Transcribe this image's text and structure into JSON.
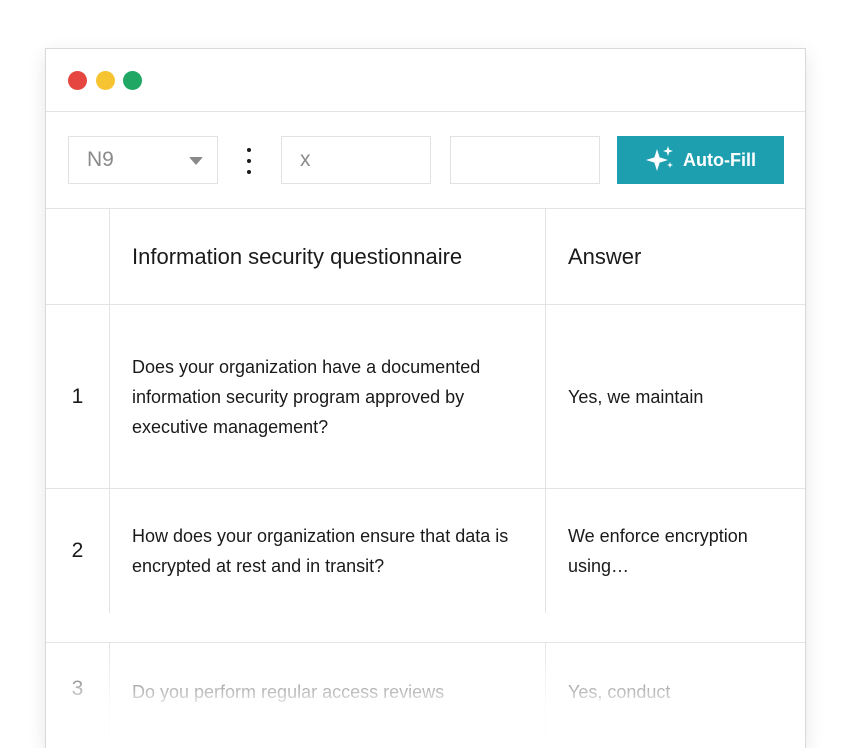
{
  "window": {
    "controls": [
      {
        "name": "close",
        "color": "#e5463f"
      },
      {
        "name": "minimize",
        "color": "#f6c431"
      },
      {
        "name": "maximize",
        "color": "#1fa763"
      }
    ]
  },
  "toolbar": {
    "cell_reference": "N9",
    "formula_value": "x",
    "value_box": "",
    "autofill_label": "Auto-Fill",
    "accent_color": "#1e9fb0"
  },
  "table": {
    "headers": {
      "number": "",
      "question": "Information security questionnaire",
      "answer": "Answer"
    },
    "rows": [
      {
        "number": "1",
        "question": "Does your organization have a documented information security program approved by executive management?",
        "answer": "Yes, we maintain"
      },
      {
        "number": "2",
        "question": "How does your organization ensure that data is encrypted at rest and in transit?",
        "answer": "We enforce encryption using…"
      },
      {
        "number": "3",
        "question": "Do you perform regular access reviews",
        "answer": "Yes, conduct"
      }
    ]
  }
}
